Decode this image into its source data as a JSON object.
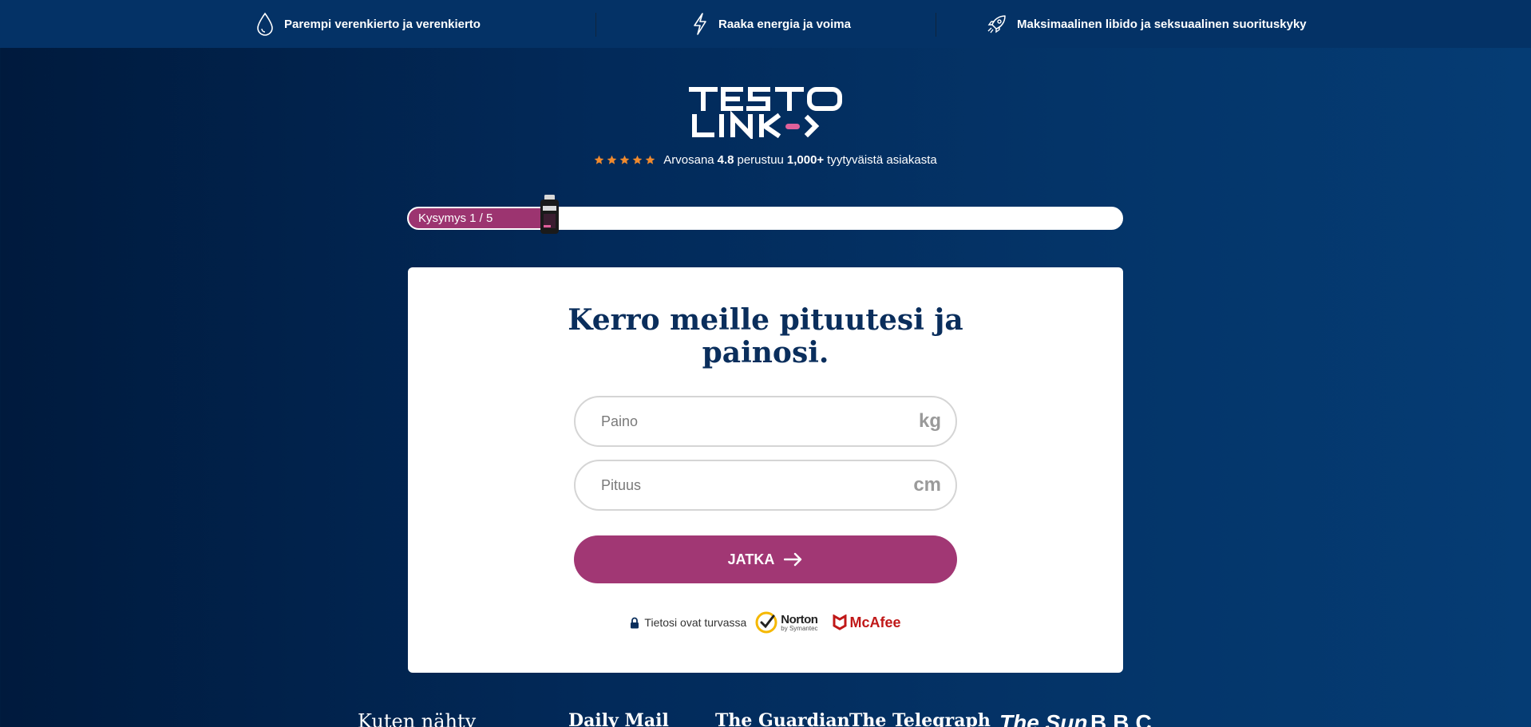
{
  "topbar": {
    "items": [
      {
        "icon": "water-drop-icon",
        "label": "Parempi verenkierto ja verenkierto"
      },
      {
        "icon": "lightning-icon",
        "label": "Raaka energia ja voima"
      },
      {
        "icon": "rocket-icon",
        "label": "Maksimaalinen libido ja seksuaalinen suorituskyky"
      }
    ]
  },
  "brand": {
    "line1": "TESTO",
    "line2": "LINK",
    "accent_color": "#e0609a"
  },
  "rating": {
    "stars": 5,
    "prefix": "Arvosana",
    "score": "4.8",
    "middle": "perustuu",
    "count": "1,000+",
    "suffix": "tyytyväistä asiakasta",
    "star_color": "#f08a2e"
  },
  "progress": {
    "label": "Kysymys 1 / 5",
    "fraction": 0.2,
    "fill_color": "#9c3470"
  },
  "form": {
    "title_line1": "Kerro meille pituutesi ja",
    "title_line2": "painosi.",
    "weight": {
      "placeholder": "Paino",
      "unit": "kg"
    },
    "height": {
      "placeholder": "Pituus",
      "unit": "cm"
    },
    "submit_label": "JATKA",
    "secure_text": "Tietosi ovat turvassa",
    "norton_name": "Norton",
    "norton_sub": "by Symantec",
    "mcafee_name": "McAfee"
  },
  "press": {
    "heading": "Kuten nähty",
    "outlets": [
      "Daily Mail",
      "The Guardian",
      "The Telegraph",
      "The Sun",
      "BBC"
    ]
  },
  "colors": {
    "topbar_bg": "#043266",
    "title_color": "#0a2e5c",
    "cta_bg": "#a13774"
  }
}
